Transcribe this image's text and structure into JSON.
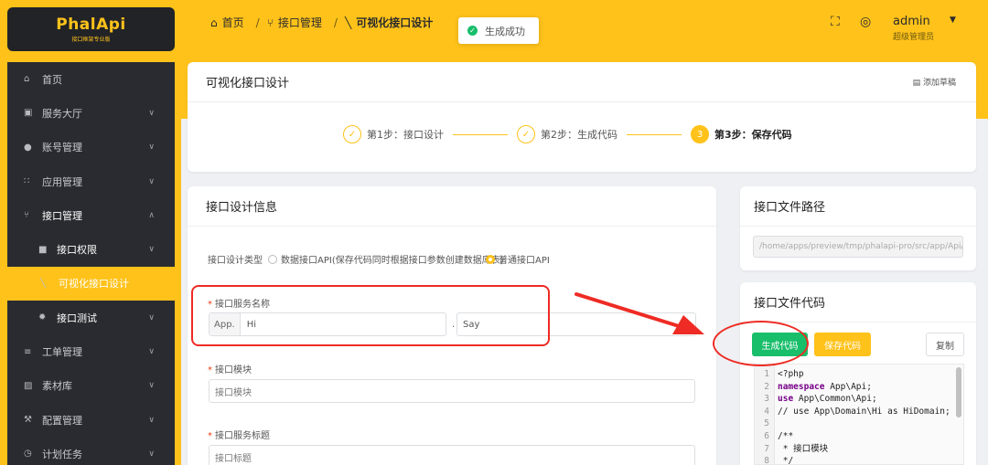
{
  "logo": {
    "text": "PhalApi",
    "subtitle": "接口框架专业版"
  },
  "menu": [
    {
      "icon": "home-icon",
      "glyph": "⌂",
      "label": "首页",
      "arrow": ""
    },
    {
      "icon": "cart-icon",
      "glyph": "▣",
      "label": "服务大厅",
      "arrow": "∨"
    },
    {
      "icon": "user-icon",
      "glyph": "●",
      "label": "账号管理",
      "arrow": "∨"
    },
    {
      "icon": "grid-icon",
      "glyph": "∷",
      "label": "应用管理",
      "arrow": "∨"
    },
    {
      "icon": "branch-icon",
      "glyph": "⑂",
      "label": "接口管理",
      "arrow": "∧"
    },
    {
      "icon": "lock-icon",
      "glyph": "■",
      "label": "接口权限",
      "arrow": "∨"
    },
    {
      "icon": "wand-icon",
      "glyph": "╲",
      "label": "可视化接口设计",
      "arrow": ""
    },
    {
      "icon": "bug-icon",
      "glyph": "✹",
      "label": "接口测试",
      "arrow": "∨"
    },
    {
      "icon": "ticket-icon",
      "glyph": "≡",
      "label": "工单管理",
      "arrow": "∨"
    },
    {
      "icon": "image-icon",
      "glyph": "▨",
      "label": "素材库",
      "arrow": "∨"
    },
    {
      "icon": "wrench-icon",
      "glyph": "⚒",
      "label": "配置管理",
      "arrow": "∨"
    },
    {
      "icon": "clock-icon",
      "glyph": "◷",
      "label": "计划任务",
      "arrow": "∨"
    }
  ],
  "breadcrumb": {
    "home": "首页",
    "section": "接口管理",
    "current": "可视化接口设计"
  },
  "toast": {
    "text": "生成成功"
  },
  "user": {
    "name": "admin",
    "role": "超级管理员"
  },
  "page": {
    "title": "可视化接口设计",
    "draft_link": "添加草稿"
  },
  "steps": [
    {
      "label": "第1步：接口设计",
      "mark": "✓",
      "status": "done"
    },
    {
      "label": "第2步：生成代码",
      "mark": "✓",
      "status": "done"
    },
    {
      "label": "第3步：保存代码",
      "mark": "3",
      "status": "current"
    }
  ],
  "design": {
    "title": "接口设计信息",
    "type_label": "接口设计类型",
    "type_option_db": "数据接口API(保存代码同时根据接口参数创建数据库表)",
    "type_option_normal": "普通接口API",
    "selected_type": "普通接口API",
    "service_label": "接口服务名称",
    "service_prefix": "App.",
    "service_class": "Hi",
    "service_dot": ".",
    "service_action": "Say",
    "module_label": "接口模块",
    "module_placeholder": "接口模块",
    "title_label": "接口服务标题",
    "title_placeholder": "接口标题"
  },
  "file_path": {
    "title": "接口文件路径",
    "value": "/home/apps/preview/tmp/phalapi-pro/src/app/Api/Hi/"
  },
  "file_code": {
    "title": "接口文件代码",
    "generate_label": "生成代码",
    "save_label": "保存代码",
    "copy_label": "复制",
    "lines": [
      {
        "n": "1",
        "text": "<?php"
      },
      {
        "n": "2",
        "kw": "namespace",
        "text": " App\\Api;"
      },
      {
        "n": "3",
        "kw": "use",
        "text": " App\\Common\\Api;"
      },
      {
        "n": "4",
        "text": "// use App\\Domain\\Hi as HiDomain;"
      },
      {
        "n": "5",
        "text": ""
      },
      {
        "n": "6",
        "text": "/**"
      },
      {
        "n": "7",
        "text": " * 接口模块"
      },
      {
        "n": "8",
        "text": " */"
      }
    ]
  },
  "colors": {
    "accent": "#ffc21a",
    "sidebar_dark": "#2a2b30",
    "generate_btn": "#19be6b",
    "annotation_red": "#ee2b24"
  }
}
